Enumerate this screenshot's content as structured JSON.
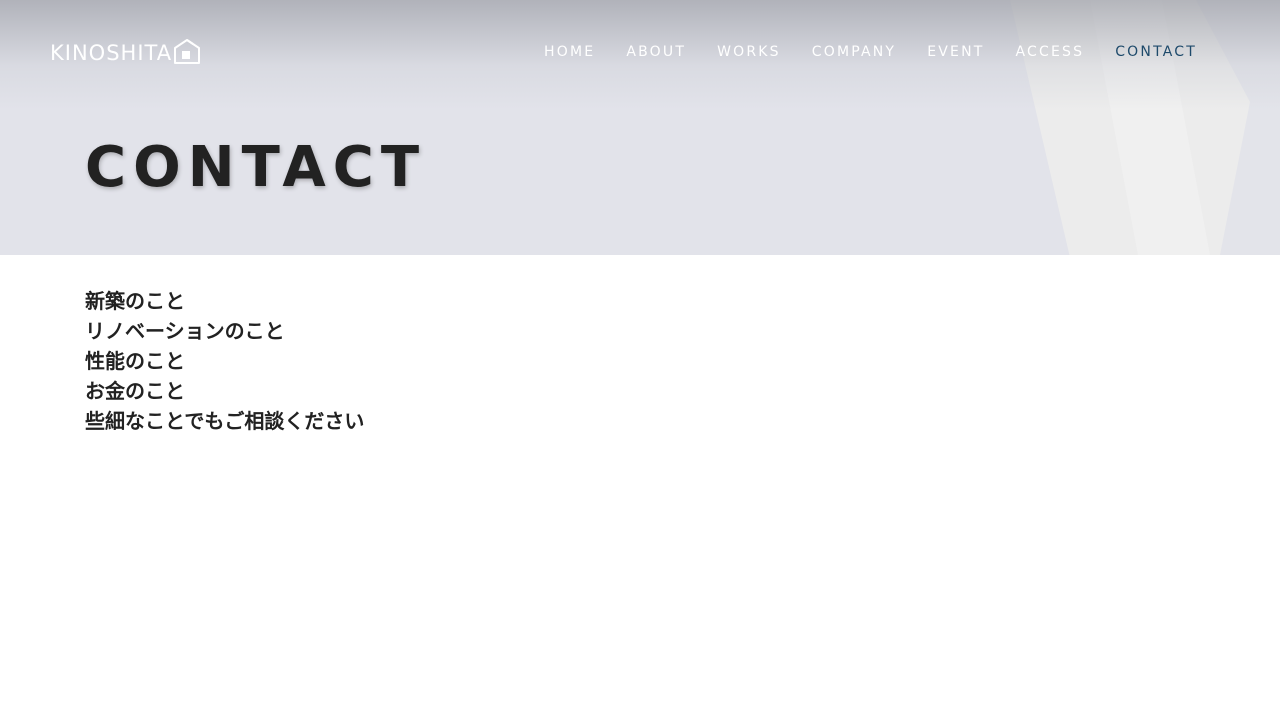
{
  "logo": {
    "text": "KINOSHITA",
    "icon": "house-icon"
  },
  "nav": {
    "items": [
      {
        "label": "HOME",
        "active": false
      },
      {
        "label": "ABOUT",
        "active": false
      },
      {
        "label": "WORKS",
        "active": false
      },
      {
        "label": "COMPANY",
        "active": false
      },
      {
        "label": "EVENT",
        "active": false
      },
      {
        "label": "ACCESS",
        "active": false
      },
      {
        "label": "CONTACT",
        "active": true
      }
    ],
    "active_color": "#1e4a6b",
    "default_color": "#ffffff"
  },
  "hero": {
    "title": "CONTACT",
    "background_color": "#e2e3ea"
  },
  "content": {
    "lines": [
      "新築のこと",
      "リノベーションのこと",
      "性能のこと",
      "お金のこと",
      "些細なことでもご相談ください"
    ]
  }
}
